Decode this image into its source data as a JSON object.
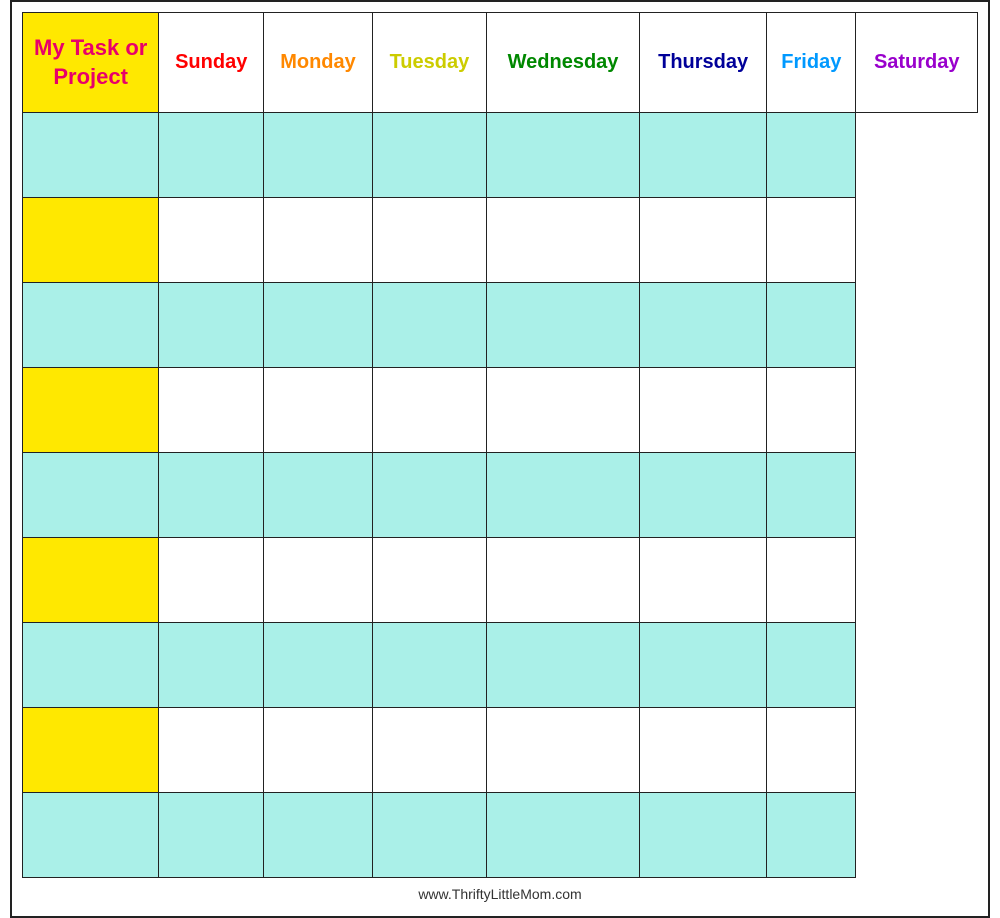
{
  "header": {
    "task_line1": "My Task or",
    "task_line2": "Project"
  },
  "days": [
    {
      "label": "Sunday",
      "class": "day-sunday"
    },
    {
      "label": "Monday",
      "class": "day-monday"
    },
    {
      "label": "Tuesday",
      "class": "day-tuesday"
    },
    {
      "label": "Wednesday",
      "class": "day-wednesday"
    },
    {
      "label": "Thursday",
      "class": "day-thursday"
    },
    {
      "label": "Friday",
      "class": "day-friday"
    },
    {
      "label": "Saturday",
      "class": "day-saturday"
    }
  ],
  "rows": [
    {
      "task_color": "cyan",
      "day_colors": [
        "cyan",
        "cyan",
        "cyan",
        "cyan",
        "cyan",
        "cyan"
      ]
    },
    {
      "task_color": "yellow",
      "day_colors": [
        "white",
        "white",
        "white",
        "white",
        "white",
        "white"
      ]
    },
    {
      "task_color": "cyan",
      "day_colors": [
        "cyan",
        "cyan",
        "cyan",
        "cyan",
        "cyan",
        "cyan"
      ]
    },
    {
      "task_color": "yellow",
      "day_colors": [
        "white",
        "white",
        "white",
        "white",
        "white",
        "white"
      ]
    },
    {
      "task_color": "cyan",
      "day_colors": [
        "cyan",
        "cyan",
        "cyan",
        "cyan",
        "cyan",
        "cyan"
      ]
    },
    {
      "task_color": "yellow",
      "day_colors": [
        "white",
        "white",
        "white",
        "white",
        "white",
        "white"
      ]
    },
    {
      "task_color": "cyan",
      "day_colors": [
        "cyan",
        "cyan",
        "cyan",
        "cyan",
        "cyan",
        "cyan"
      ]
    },
    {
      "task_color": "yellow",
      "day_colors": [
        "white",
        "white",
        "white",
        "white",
        "white",
        "white"
      ]
    },
    {
      "task_color": "cyan",
      "day_colors": [
        "cyan",
        "cyan",
        "cyan",
        "cyan",
        "cyan",
        "cyan"
      ]
    }
  ],
  "footer": {
    "url": "www.ThriftyLittleMom.com"
  }
}
